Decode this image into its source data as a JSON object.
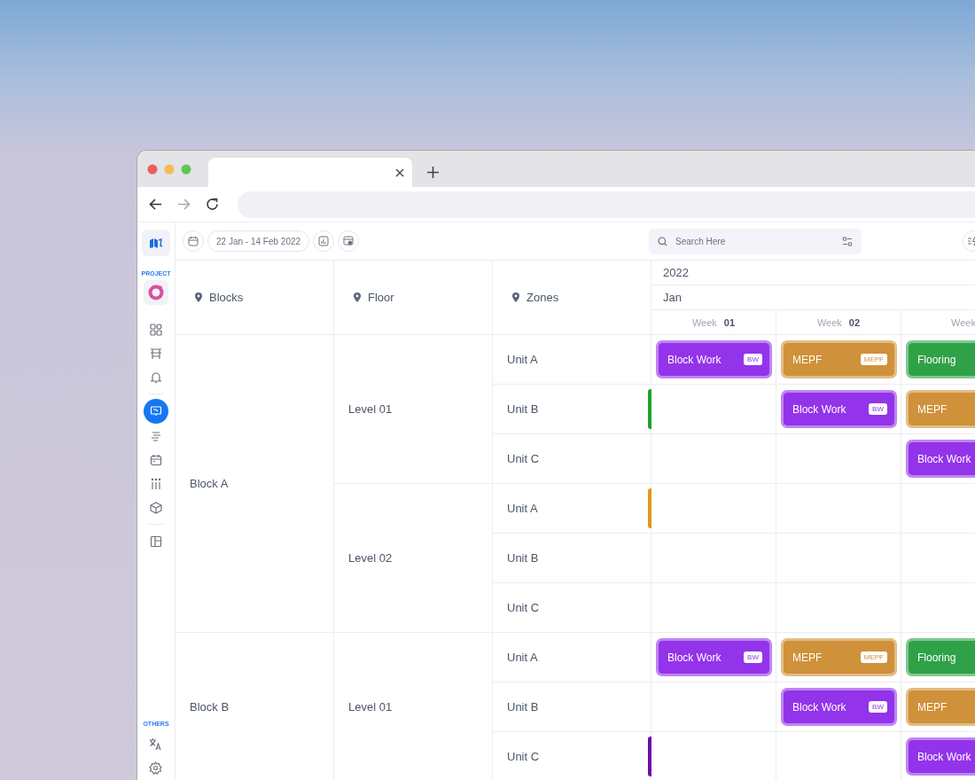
{
  "sidebar": {
    "project_label": "PROJECT",
    "others_label": "OTHERS",
    "items": [
      {
        "selected": false
      },
      {
        "selected": false
      },
      {
        "selected": false
      },
      {
        "selected": true
      },
      {
        "selected": false
      },
      {
        "selected": false
      },
      {
        "selected": false
      },
      {
        "selected": false
      },
      {
        "selected": false
      }
    ],
    "bottom_items": [
      {
        "selected": false
      },
      {
        "selected": false
      }
    ]
  },
  "toolbar": {
    "date_range": "22 Jan - 14 Feb 2022",
    "search": {
      "placeholder": "Search Here"
    }
  },
  "table": {
    "columns": [
      {
        "label": "Blocks"
      },
      {
        "label": "Floor"
      },
      {
        "label": "Zones"
      }
    ],
    "year": "2022",
    "month": "Jan",
    "weeks": [
      {
        "label": "Week",
        "number": "01"
      },
      {
        "label": "Week",
        "number": "02"
      },
      {
        "label": "Week"
      }
    ],
    "blocks": [
      {
        "name": "Block A",
        "levels": [
          {
            "name": "Level 01",
            "units": [
              {
                "name": "Unit A",
                "cells": [
                  {
                    "label": "Block Work",
                    "tag": "BW",
                    "color": "#9333ea"
                  },
                  {
                    "label": "MEPF",
                    "tag": "MEPF",
                    "color": "#cf9139"
                  },
                  {
                    "label": "Flooring",
                    "color": "#2fa147"
                  }
                ]
              },
              {
                "name": "Unit B",
                "color": "#1aa32c",
                "cells": [
                  null,
                  {
                    "label": "Block Work",
                    "tag": "BW",
                    "color": "#9333ea"
                  },
                  {
                    "label": "MEPF",
                    "color": "#cf9139"
                  }
                ]
              },
              {
                "name": "Unit C",
                "cells": [
                  null,
                  null,
                  {
                    "label": "Block Work",
                    "color": "#9333ea"
                  }
                ]
              }
            ]
          },
          {
            "name": "Level 02",
            "units": [
              {
                "name": "Unit A",
                "color": "#e0981a",
                "cells": [
                  null,
                  null,
                  null
                ]
              },
              {
                "name": "Unit B",
                "cells": [
                  null,
                  null,
                  null
                ]
              },
              {
                "name": "Unit C",
                "cells": [
                  null,
                  null,
                  null
                ]
              }
            ]
          }
        ]
      },
      {
        "name": "Block B",
        "levels": [
          {
            "name": "Level 01",
            "units": [
              {
                "name": "Unit A",
                "cells": [
                  {
                    "label": "Block Work",
                    "tag": "BW",
                    "color": "#9333ea"
                  },
                  {
                    "label": "MEPF",
                    "tag": "MEPF",
                    "color": "#cf9139"
                  },
                  {
                    "label": "Flooring",
                    "color": "#2fa147"
                  }
                ]
              },
              {
                "name": "Unit B",
                "cells": [
                  null,
                  {
                    "label": "Block Work",
                    "tag": "BW",
                    "color": "#9333ea"
                  },
                  {
                    "label": "MEPF",
                    "color": "#cf9139"
                  }
                ]
              },
              {
                "name": "Unit C",
                "color": "#6b0aa8",
                "cells": [
                  null,
                  null,
                  {
                    "label": "Block Work",
                    "color": "#9333ea"
                  }
                ]
              }
            ]
          }
        ]
      }
    ]
  }
}
